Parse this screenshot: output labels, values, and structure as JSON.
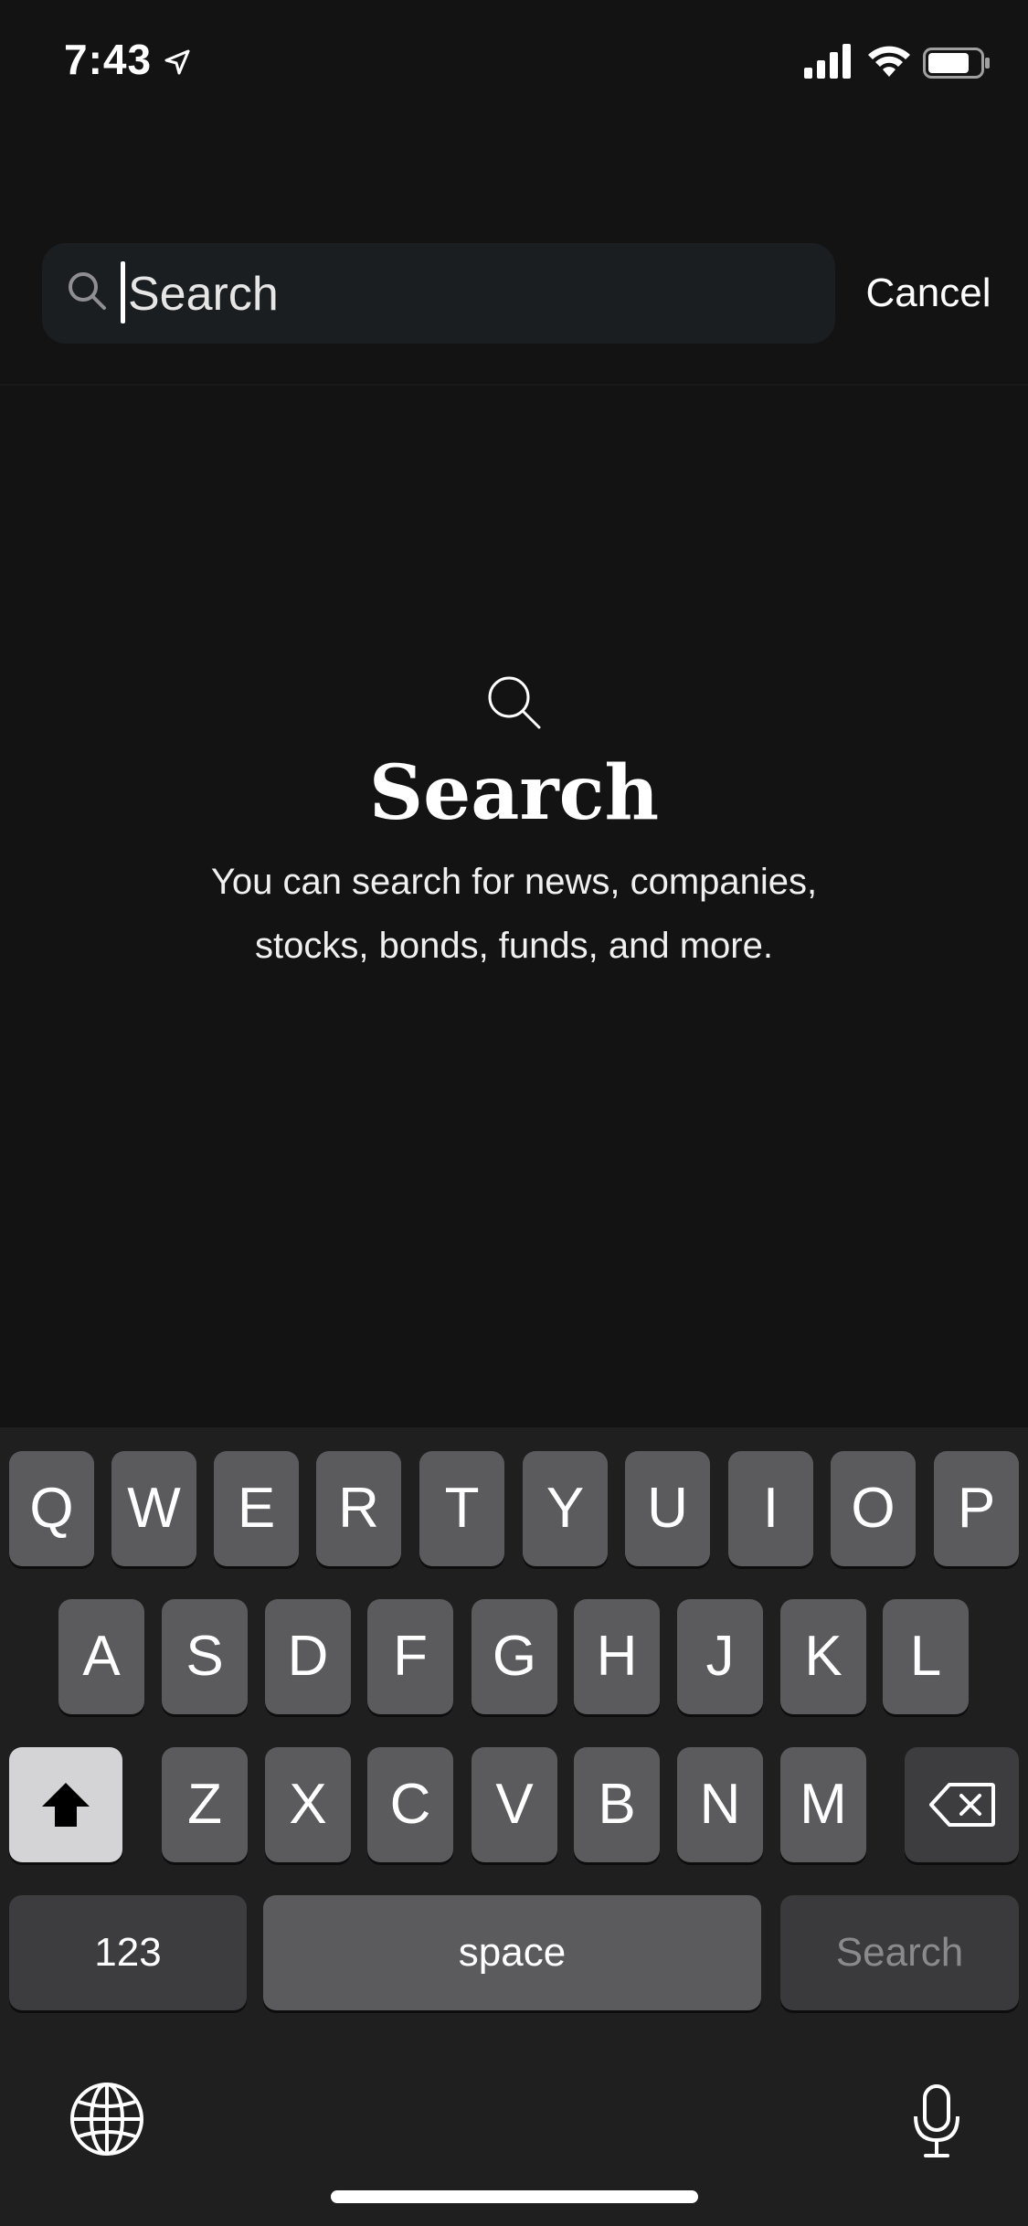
{
  "status_bar": {
    "time": "7:43",
    "icons": [
      "location-arrow-icon",
      "cellular-signal-icon",
      "wifi-icon",
      "battery-icon"
    ]
  },
  "search": {
    "placeholder": "Search",
    "value": "",
    "cancel_label": "Cancel"
  },
  "empty_state": {
    "icon": "search-icon",
    "title": "Search",
    "description_line1": "You can search for news, companies,",
    "description_line2": "stocks, bonds, funds, and more."
  },
  "keyboard": {
    "row1": [
      "Q",
      "W",
      "E",
      "R",
      "T",
      "Y",
      "U",
      "I",
      "O",
      "P"
    ],
    "row2": [
      "A",
      "S",
      "D",
      "F",
      "G",
      "H",
      "J",
      "K",
      "L"
    ],
    "row3": [
      "Z",
      "X",
      "C",
      "V",
      "B",
      "N",
      "M"
    ],
    "numbers_label": "123",
    "space_label": "space",
    "return_label": "Search",
    "shift_icon": "shift-icon",
    "delete_icon": "delete-icon",
    "globe_icon": "globe-icon",
    "mic_icon": "microphone-icon"
  },
  "colors": {
    "background": "#131314",
    "search_field": "#1b1e21",
    "keyboard_bg": "#1f1f20",
    "key": "#5b5b5d",
    "key_dark": "#3d3d3f",
    "key_light": "#d4d4d6"
  }
}
